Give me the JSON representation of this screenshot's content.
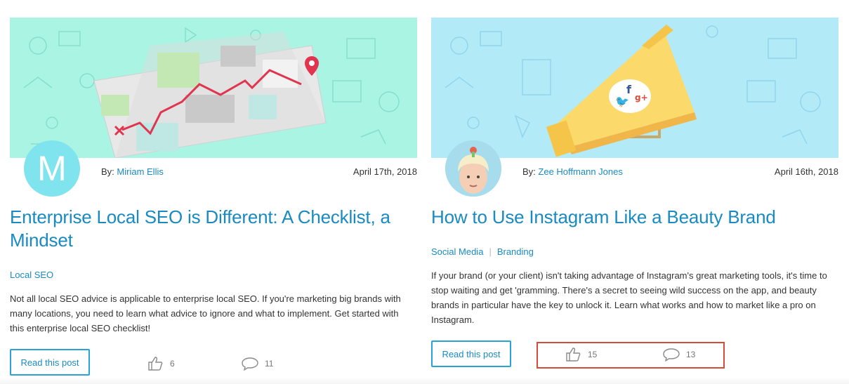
{
  "posts": [
    {
      "author_prefix": "By:",
      "author": "Miriam Ellis",
      "date": "April 17th, 2018",
      "title": "Enterprise Local SEO is Different: A Checklist, a Mindset",
      "categories": [
        "Local SEO"
      ],
      "excerpt": "Not all local SEO advice is applicable to enterprise local SEO. If you're marketing big brands with many locations, you need to learn what advice to ignore and what to implement. Get started with this enterprise local SEO checklist!",
      "read_label": "Read this post",
      "likes": "6",
      "comments": "11",
      "avatar_letter": "M",
      "hero_color": "#a9f4e3"
    },
    {
      "author_prefix": "By:",
      "author": "Zee Hoffmann Jones",
      "date": "April 16th, 2018",
      "title": "How to Use Instagram Like a Beauty Brand",
      "categories": [
        "Social Media",
        "Branding"
      ],
      "category_separator": "|",
      "excerpt": "If your brand (or your client) isn't taking advantage of Instagram's great marketing tools, it's time to stop waiting and get 'gramming. There's a secret to seeing wild success on the app, and beauty brands in particular have the key to unlock it. Learn what works and how to market like a pro on Instagram.",
      "read_label": "Read this post",
      "likes": "15",
      "comments": "13",
      "hero_color": "#b3eaf8"
    }
  ],
  "icons": {
    "like": "thumbs-up-icon",
    "comment": "comment-bubble-icon"
  },
  "colors": {
    "link": "#1a8ac2",
    "button_border": "#2aa3d8",
    "highlight": "#d64a3a"
  }
}
